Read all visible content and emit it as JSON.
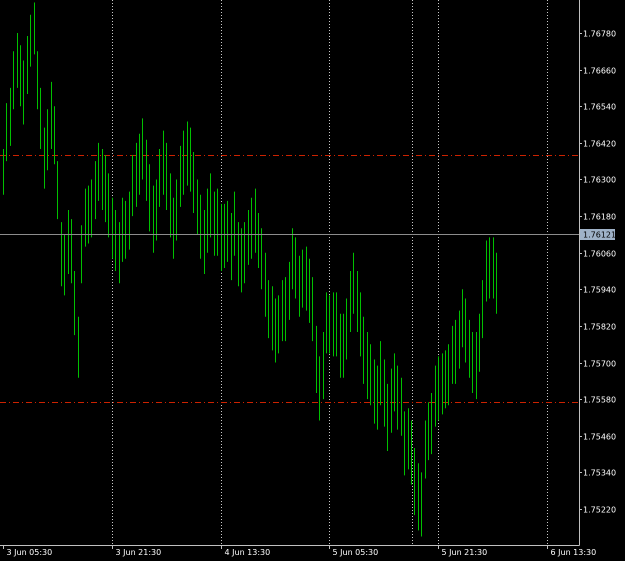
{
  "colors": {
    "background": "#000000",
    "axis": "#c0c0c0",
    "grid": "#c8c8c8",
    "bars": "#00c000",
    "bid_line": "#8c8c8c",
    "level_line": "#cc2200",
    "badge_bg": "#9fb2c8",
    "text": "#ffffff"
  },
  "chart_data": {
    "type": "line",
    "style": "bars",
    "current_price": "1.76121",
    "current_price_value": 1.76121,
    "level_lines": [
      1.7638,
      1.7557
    ],
    "ylim": [
      1.751,
      1.769
    ],
    "yticks": [
      {
        "label": "1.76780",
        "value": 1.7678
      },
      {
        "label": "1.76660",
        "value": 1.7666
      },
      {
        "label": "1.76540",
        "value": 1.7654
      },
      {
        "label": "1.76420",
        "value": 1.7642
      },
      {
        "label": "1.76300",
        "value": 1.763
      },
      {
        "label": "1.76180",
        "value": 1.7618
      },
      {
        "label": "1.76060",
        "value": 1.7606
      },
      {
        "label": "1.75940",
        "value": 1.7594
      },
      {
        "label": "1.75820",
        "value": 1.7582
      },
      {
        "label": "1.75700",
        "value": 1.757
      },
      {
        "label": "1.75580",
        "value": 1.7558
      },
      {
        "label": "1.75460",
        "value": 1.7546
      },
      {
        "label": "1.75340",
        "value": 1.7534
      },
      {
        "label": "1.75220",
        "value": 1.7522
      }
    ],
    "xtick_labels": [
      {
        "label": "3 Jun 05:30",
        "bar_index": 0
      },
      {
        "label": "3 Jun 21:30",
        "bar_index": 32
      },
      {
        "label": "4 Jun 13:30",
        "bar_index": 64
      },
      {
        "label": "5 Jun 05:30",
        "bar_index": 96
      },
      {
        "label": "5 Jun 21:30",
        "bar_index": 128
      },
      {
        "label": "6 Jun 13:30",
        "bar_index": 160
      }
    ],
    "grid": true,
    "bar_count": 186,
    "bars_high": [
      1.764,
      1.7655,
      1.766,
      1.7672,
      1.7678,
      1.7674,
      1.7669,
      1.7677,
      1.7684,
      1.7688,
      1.7672,
      1.766,
      1.7647,
      1.7653,
      1.7662,
      1.7654,
      1.7636,
      1.7616,
      1.7612,
      1.762,
      1.7617,
      1.76,
      1.7585,
      1.7615,
      1.7627,
      1.7628,
      1.763,
      1.7636,
      1.7642,
      1.764,
      1.7638,
      1.7632,
      1.7624,
      1.762,
      1.7616,
      1.7624,
      1.7623,
      1.7626,
      1.7638,
      1.7642,
      1.7645,
      1.765,
      1.7643,
      1.7635,
      1.7628,
      1.763,
      1.764,
      1.7646,
      1.7642,
      1.7632,
      1.7624,
      1.763,
      1.7641,
      1.7646,
      1.7649,
      1.7647,
      1.7639,
      1.763,
      1.7625,
      1.762,
      1.7627,
      1.7632,
      1.7626,
      1.7627,
      1.7622,
      1.7622,
      1.7623,
      1.7619,
      1.7626,
      1.7616,
      1.7614,
      1.7616,
      1.762,
      1.7624,
      1.7627,
      1.7619,
      1.7614,
      1.7606,
      1.7597,
      1.7595,
      1.7591,
      1.7592,
      1.7597,
      1.7598,
      1.7603,
      1.7614,
      1.7611,
      1.7605,
      1.7607,
      1.7608,
      1.7604,
      1.7598,
      1.7582,
      1.7572,
      1.758,
      1.7593,
      1.7592,
      1.7593,
      1.7593,
      1.7586,
      1.7586,
      1.7591,
      1.76,
      1.7606,
      1.76,
      1.7593,
      1.7585,
      1.758,
      1.7576,
      1.7571,
      1.7569,
      1.7577,
      1.7571,
      1.7563,
      1.7568,
      1.7573,
      1.7569,
      1.7565,
      1.7554,
      1.7555,
      1.7551,
      1.7542,
      1.7537,
      1.7534,
      1.7551,
      1.7557,
      1.756,
      1.7569,
      1.7572,
      1.7573,
      1.7574,
      1.7576,
      1.7582,
      1.7584,
      1.7587,
      1.7594,
      1.7591,
      1.7584,
      1.758,
      1.758,
      1.7586,
      1.7597,
      1.761,
      1.7611,
      1.7611,
      1.7606
    ],
    "bars_low": [
      1.7625,
      1.7636,
      1.7641,
      1.7653,
      1.766,
      1.7654,
      1.7648,
      1.7658,
      1.7667,
      1.7671,
      1.7653,
      1.764,
      1.7627,
      1.7633,
      1.764,
      1.7635,
      1.7617,
      1.7595,
      1.7592,
      1.7599,
      1.7596,
      1.7579,
      1.7565,
      1.7596,
      1.7608,
      1.7609,
      1.7611,
      1.7617,
      1.7623,
      1.762,
      1.7616,
      1.7611,
      1.7604,
      1.76,
      1.7596,
      1.7603,
      1.7604,
      1.7607,
      1.7618,
      1.7621,
      1.7625,
      1.763,
      1.7623,
      1.7613,
      1.7606,
      1.761,
      1.7621,
      1.7625,
      1.762,
      1.7611,
      1.7604,
      1.761,
      1.7621,
      1.7625,
      1.7628,
      1.7626,
      1.7619,
      1.7612,
      1.7604,
      1.7599,
      1.7606,
      1.7611,
      1.7605,
      1.7605,
      1.76,
      1.7601,
      1.7603,
      1.7597,
      1.7605,
      1.7595,
      1.7593,
      1.7596,
      1.7602,
      1.7604,
      1.7606,
      1.7601,
      1.7594,
      1.7585,
      1.7578,
      1.7574,
      1.757,
      1.7573,
      1.7577,
      1.7577,
      1.7584,
      1.7594,
      1.7591,
      1.7585,
      1.7588,
      1.7587,
      1.7583,
      1.7577,
      1.756,
      1.7551,
      1.7558,
      1.7573,
      1.7573,
      1.7572,
      1.7572,
      1.7565,
      1.7565,
      1.7571,
      1.758,
      1.7586,
      1.758,
      1.7572,
      1.7563,
      1.7558,
      1.7556,
      1.755,
      1.7548,
      1.7556,
      1.7549,
      1.7541,
      1.7547,
      1.7554,
      1.7548,
      1.7546,
      1.7533,
      1.7535,
      1.753,
      1.752,
      1.7515,
      1.7513,
      1.7532,
      1.7538,
      1.754,
      1.7549,
      1.7551,
      1.7553,
      1.7555,
      1.7556,
      1.7563,
      1.7563,
      1.7568,
      1.7575,
      1.757,
      1.7565,
      1.756,
      1.7558,
      1.7567,
      1.7578,
      1.759,
      1.7591,
      1.7591,
      1.7586
    ]
  }
}
